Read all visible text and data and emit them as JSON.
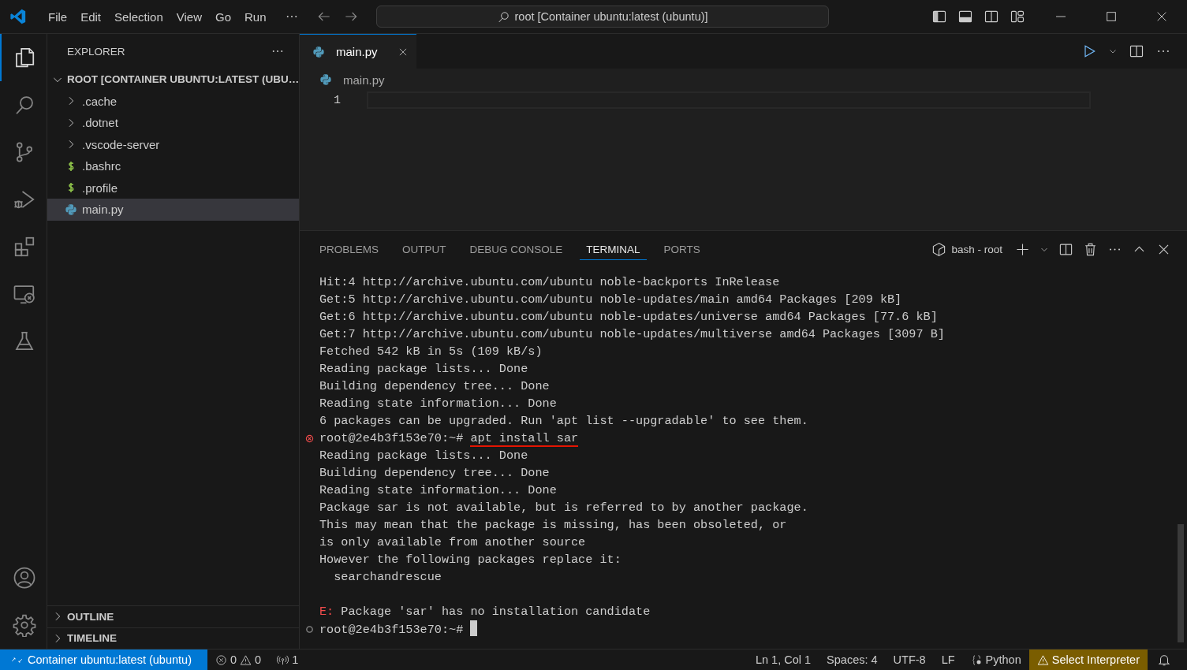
{
  "title_bar": {
    "menu": [
      "File",
      "Edit",
      "Selection",
      "View",
      "Go",
      "Run"
    ],
    "command_center": "root [Container ubuntu:latest (ubuntu)]"
  },
  "activity_bar": [
    {
      "kind": "explorer",
      "selected": true
    },
    {
      "kind": "search",
      "selected": false
    },
    {
      "kind": "source-control",
      "selected": false
    },
    {
      "kind": "run-debug",
      "selected": false
    },
    {
      "kind": "extensions",
      "selected": false
    },
    {
      "kind": "remote",
      "selected": false
    },
    {
      "kind": "testing",
      "selected": false
    }
  ],
  "sidebar": {
    "title": "EXPLORER",
    "root": {
      "label": "ROOT [CONTAINER UBUNTU:LATEST (UBU…",
      "expanded": true
    },
    "items": [
      {
        "label": ".cache",
        "kind": "folder",
        "expanded": false,
        "selected": false
      },
      {
        "label": ".dotnet",
        "kind": "folder",
        "expanded": false,
        "selected": false
      },
      {
        "label": ".vscode-server",
        "kind": "folder",
        "expanded": false,
        "selected": false
      },
      {
        "label": ".bashrc",
        "kind": "shell",
        "selected": false
      },
      {
        "label": ".profile",
        "kind": "shell",
        "selected": false
      },
      {
        "label": "main.py",
        "kind": "python",
        "selected": true
      }
    ],
    "sections": [
      {
        "label": "OUTLINE",
        "expanded": false
      },
      {
        "label": "TIMELINE",
        "expanded": false
      }
    ]
  },
  "editor": {
    "tabs": [
      {
        "label": "main.py",
        "selected": true
      }
    ],
    "breadcrumb": "main.py",
    "line_numbers": [
      "1"
    ]
  },
  "panel": {
    "tabs": [
      {
        "label": "PROBLEMS",
        "selected": false
      },
      {
        "label": "OUTPUT",
        "selected": false
      },
      {
        "label": "DEBUG CONSOLE",
        "selected": false
      },
      {
        "label": "TERMINAL",
        "selected": true
      },
      {
        "label": "PORTS",
        "selected": false
      }
    ],
    "terminal_name": "bash - root",
    "lines": [
      {
        "kind": "output",
        "text": "Hit:4 http://archive.ubuntu.com/ubuntu noble-backports InRelease"
      },
      {
        "kind": "output",
        "text": "Get:5 http://archive.ubuntu.com/ubuntu noble-updates/main amd64 Packages [209 kB]"
      },
      {
        "kind": "output",
        "text": "Get:6 http://archive.ubuntu.com/ubuntu noble-updates/universe amd64 Packages [77.6 kB]"
      },
      {
        "kind": "output",
        "text": "Get:7 http://archive.ubuntu.com/ubuntu noble-updates/multiverse amd64 Packages [3097 B]"
      },
      {
        "kind": "output",
        "text": "Fetched 542 kB in 5s (109 kB/s)"
      },
      {
        "kind": "output",
        "text": "Reading package lists... Done"
      },
      {
        "kind": "output",
        "text": "Building dependency tree... Done"
      },
      {
        "kind": "output",
        "text": "Reading state information... Done"
      },
      {
        "kind": "output",
        "text": "6 packages can be upgraded. Run 'apt list --upgradable' to see them."
      },
      {
        "kind": "prompt",
        "prompt": "root@2e4b3f153e70:~#",
        "command": "apt install sar",
        "failed": true,
        "underlined": true
      },
      {
        "kind": "output",
        "text": "Reading package lists... Done"
      },
      {
        "kind": "output",
        "text": "Building dependency tree... Done"
      },
      {
        "kind": "output",
        "text": "Reading state information... Done"
      },
      {
        "kind": "output",
        "text": "Package sar is not available, but is referred to by another package."
      },
      {
        "kind": "output",
        "text": "This may mean that the package is missing, has been obsoleted, or"
      },
      {
        "kind": "output",
        "text": "is only available from another source"
      },
      {
        "kind": "output",
        "text": "However the following packages replace it:"
      },
      {
        "kind": "output",
        "text": "  searchandrescue"
      },
      {
        "kind": "blank"
      },
      {
        "kind": "error",
        "prefix": "E:",
        "text": "Package 'sar' has no installation candidate"
      },
      {
        "kind": "prompt",
        "prompt": "root@2e4b3f153e70:~#",
        "failed": false,
        "cursor": true
      }
    ]
  },
  "status_bar": {
    "remote": "Container ubuntu:latest (ubuntu)",
    "errors": "0",
    "warnings": "0",
    "ports": "1",
    "items": [
      "Ln 1, Col 1",
      "Spaces: 4",
      "UTF-8",
      "LF"
    ],
    "language": "Python",
    "interpreter": "Select Interpreter"
  }
}
